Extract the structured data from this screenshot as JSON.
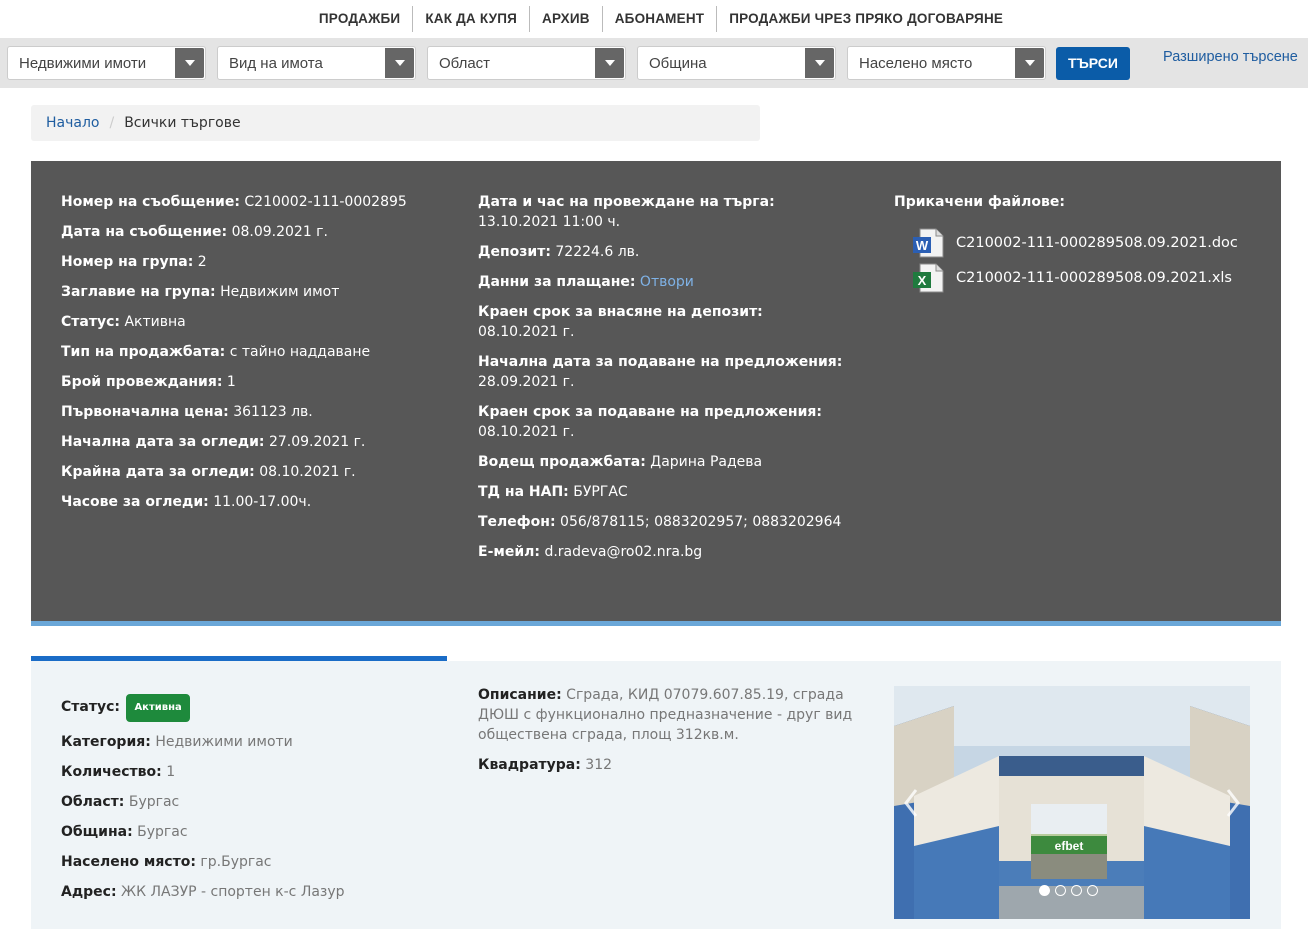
{
  "nav": {
    "items": [
      "ПРОДАЖБИ",
      "КАК ДА КУПЯ",
      "АРХИВ",
      "АБОНАМЕНТ",
      "ПРОДАЖБИ ЧРЕЗ ПРЯКО ДОГОВАРЯНЕ"
    ]
  },
  "search": {
    "category": "Недвижими имоти",
    "property_type": "Вид на имота",
    "region": "Област",
    "municipality": "Община",
    "settlement": "Населено място",
    "button": "ТЪРСИ",
    "advanced": "Разширено търсене"
  },
  "breadcrumb": {
    "home": "Начало",
    "separator": "/",
    "current": "Всички търгове"
  },
  "notice": {
    "left": [
      {
        "label": "Номер на съобщение:",
        "value": "C210002-111-0002895"
      },
      {
        "label": "Дата на съобщение:",
        "value": "08.09.2021 г."
      },
      {
        "label": "Номер на група:",
        "value": "2"
      },
      {
        "label": "Заглавие на група:",
        "value": "Недвижим имот"
      },
      {
        "label": "Статус:",
        "value": "Активна"
      },
      {
        "label": "Тип на продажбата:",
        "value": "с тайно наддаване"
      },
      {
        "label": "Брой провеждания:",
        "value": "1"
      },
      {
        "label": "Първоначална цена:",
        "value": "361123 лв."
      },
      {
        "label": "Начална дата за огледи:",
        "value": "27.09.2021 г."
      },
      {
        "label": "Крайна дата за огледи:",
        "value": "08.10.2021 г."
      },
      {
        "label": "Часове за огледи:",
        "value": "11.00-17.00ч."
      }
    ],
    "middle": [
      {
        "label": "Дата и час на провеждане на търга:",
        "value": "13.10.2021 11:00 ч."
      },
      {
        "label": "Депозит:",
        "value": "72224.6 лв."
      },
      {
        "label": "Данни за плащане:",
        "value": "Отвори"
      },
      {
        "label": "Краен срок за внасяне на депозит:",
        "value": "08.10.2021 г."
      },
      {
        "label": "Начална дата за подаване на предложения:",
        "value": "28.09.2021 г."
      },
      {
        "label": "Краен срок за подаване на предложения:",
        "value": "08.10.2021 г."
      },
      {
        "label": "Водещ продажбата:",
        "value": "Дарина Радева"
      },
      {
        "label": "ТД на НАП:",
        "value": "БУРГАС"
      },
      {
        "label": "Телефон:",
        "value": "056/878115; 0883202957; 0883202964"
      },
      {
        "label": "E-мейл:",
        "value": "d.radeva@ro02.nra.bg"
      }
    ],
    "files_title": "Прикачени файлове:",
    "files": [
      {
        "name": "C210002-111-000289508.09.2021.doc",
        "icon": "word-doc-icon",
        "color": "#2b5fb4"
      },
      {
        "name": "C210002-111-000289508.09.2021.xls",
        "icon": "excel-xls-icon",
        "color": "#1f7a3e"
      }
    ]
  },
  "item": {
    "status_label": "Статус:",
    "status_badge": "Активна",
    "left": [
      {
        "label": "Категория:",
        "value": "Недвижими имоти"
      },
      {
        "label": "Количество:",
        "value": "1"
      },
      {
        "label": "Област:",
        "value": "Бургас"
      },
      {
        "label": "Община:",
        "value": "Бургас"
      },
      {
        "label": "Населено място:",
        "value": "гр.Бургас"
      },
      {
        "label": "Адрес:",
        "value": "ЖК ЛАЗУР - спортен к-с Лазур"
      }
    ],
    "right": [
      {
        "label": "Описание:",
        "value": "Сграда, КИД 07079.607.85.19, сграда ДЮШ с функционално предназначение - друг вид обществена сграда, площ 312кв.м."
      },
      {
        "label": "Квадратура:",
        "value": "312"
      }
    ],
    "photo_sign": "efbet",
    "carousel": {
      "count": 4,
      "active": 0
    }
  },
  "colors": {
    "accent": "#0b5ca8",
    "panel": "#575757",
    "badge": "#1e8a3c",
    "tab": "#1a6cc7"
  }
}
